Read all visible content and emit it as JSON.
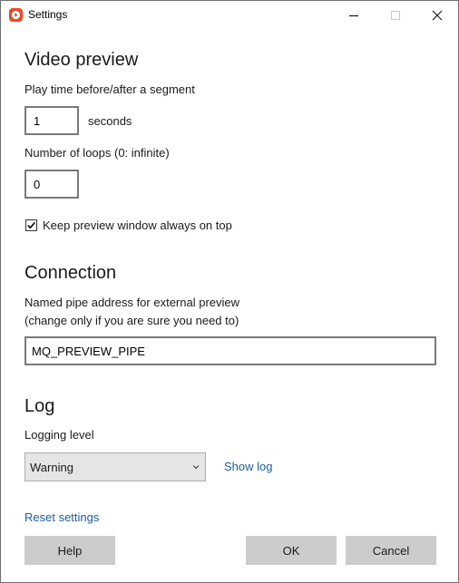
{
  "window": {
    "title": "Settings",
    "app_icon": "play-icon",
    "controls": [
      "minimize-icon",
      "maximize-icon",
      "close-icon"
    ]
  },
  "video_preview": {
    "heading": "Video preview",
    "play_time_label": "Play time before/after a segment",
    "play_time_value": "1",
    "play_time_unit": "seconds",
    "loops_label": "Number of loops (0: infinite)",
    "loops_value": "0",
    "on_top_label": "Keep preview window always on top",
    "on_top_checked": true
  },
  "connection": {
    "heading": "Connection",
    "pipe_label_line1": "Named pipe address for external preview",
    "pipe_label_line2": "(change only if you are sure you need to)",
    "pipe_value": "MQ_PREVIEW_PIPE"
  },
  "log": {
    "heading": "Log",
    "level_label": "Logging level",
    "level_value": "Warning",
    "show_log": "Show log"
  },
  "footer": {
    "reset": "Reset settings",
    "help": "Help",
    "ok": "OK",
    "cancel": "Cancel"
  }
}
